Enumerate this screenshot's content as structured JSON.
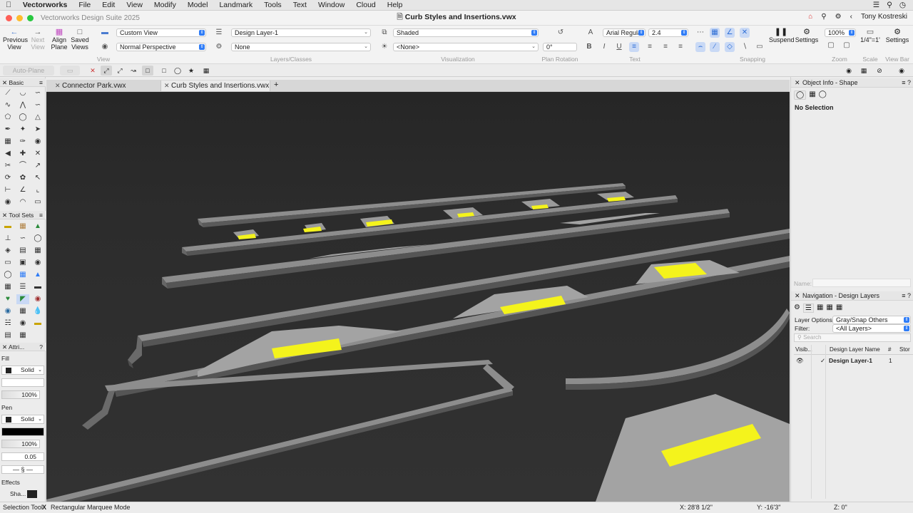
{
  "menubar": {
    "app_name": "Vectorworks",
    "items": [
      "File",
      "Edit",
      "View",
      "Modify",
      "Model",
      "Landmark",
      "Tools",
      "Text",
      "Window",
      "Cloud",
      "Help"
    ]
  },
  "window": {
    "app_title": "Vectorworks Design Suite 2025",
    "doc_title": "Curb Styles and Insertions.vwx",
    "user_name": "Tony Kostreski"
  },
  "toolbar": {
    "previous_view": "Previous View",
    "next_view": "Next View",
    "align_plane": "Align Plane",
    "saved_views": "Saved Views",
    "view_select": "Custom View",
    "projection_select": "Normal Perspective",
    "layer_select": "Design Layer-1",
    "class_select": "None",
    "render_select": "Shaded",
    "light_select": "<None>",
    "plan_rotation_value": "0°",
    "font_name": "Arial Regular",
    "font_size": "2.4",
    "suspend_label": "Suspend",
    "settings_label": "Settings",
    "zoom_value": "100%",
    "scale_value": "1/4\"=1'",
    "settings2_label": "Settings",
    "groups": {
      "view": "View",
      "layers_classes": "Layers/Classes",
      "visualization": "Visualization",
      "plan_rotation": "Plan Rotation",
      "text": "Text",
      "snapping": "Snapping",
      "zoom": "Zoom",
      "scale": "Scale",
      "view_bar": "View Bar"
    }
  },
  "modebar": {
    "auto_plane": "Auto-Plane"
  },
  "left_palette": {
    "basic_title": "Basic",
    "toolsets_title": "Tool Sets",
    "attributes_title": "Attri...",
    "fill_label": "Fill",
    "fill_style": "Solid",
    "fill_opacity": "100%",
    "pen_label": "Pen",
    "pen_style": "Solid",
    "pen_opacity": "100%",
    "line_weight": "0.05",
    "effects_label": "Effects",
    "shadow_label": "Sha..."
  },
  "tabs": [
    {
      "label": "Connector Park.vwx"
    },
    {
      "label": "Curb Styles and Insertions.vwx"
    }
  ],
  "object_info": {
    "title": "Object Info - Shape",
    "status": "No Selection",
    "name_label": "Name:"
  },
  "navigation": {
    "title": "Navigation - Design Layers",
    "layer_options_label": "Layer Options:",
    "layer_options_value": "Gray/Snap Others",
    "filter_label": "Filter:",
    "filter_value": "<All Layers>",
    "search_placeholder": "Search",
    "columns": [
      "Visib...",
      "Design Layer Name",
      "#",
      "Stor"
    ],
    "rows": [
      {
        "name": "Design Layer-1",
        "number": "1"
      }
    ]
  },
  "statusbar": {
    "tool": "Selection Tool",
    "mode": "Rectangular Marquee Mode",
    "x": "X: 28'8 1/2\"",
    "y": "Y: -16'3\"",
    "z": "Z: 0\""
  },
  "colors": {
    "accent": "#2f7cf6",
    "viewport_bg": "#2d2d2d",
    "curb_gray": "#8c8c8c",
    "marking_yellow": "#f4f31c"
  }
}
